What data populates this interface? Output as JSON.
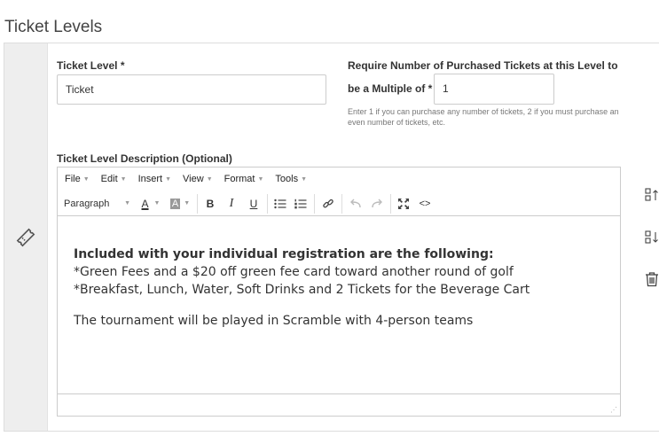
{
  "section": {
    "title": "Ticket Levels"
  },
  "ticket_level": {
    "label": "Ticket Level *",
    "value": "Ticket"
  },
  "multiple": {
    "label_line1": "Require Number of Purchased Tickets at this Level to",
    "label_line2": "be a Multiple of *",
    "value": "1",
    "help_line1": "Enter 1 if you can purchase any number of tickets, 2 if you must purchase an",
    "help_line2": "even number of tickets, etc."
  },
  "description": {
    "label": "Ticket Level Description (Optional)"
  },
  "editor": {
    "menus": [
      "File",
      "Edit",
      "Insert",
      "View",
      "Format",
      "Tools"
    ],
    "block_format": "Paragraph",
    "text_color_glyph": "A",
    "highlight_glyph": "A",
    "bold_glyph": "B",
    "italic_glyph": "I",
    "underline_glyph": "U",
    "code_glyph": "<>",
    "content": {
      "heading": "Included with your individual registration are the following:",
      "line1": "*Green Fees and a $20 off green fee card toward another round of golf",
      "line2": "*Breakfast, Lunch, Water, Soft Drinks and 2 Tickets for the Beverage Cart",
      "paragraph": "The tournament will be played in Scramble with 4-person teams"
    }
  },
  "icons": {
    "grip": "ticket-icon",
    "move_up": "move-up-icon",
    "move_down": "move-down-icon",
    "delete": "trash-icon"
  }
}
